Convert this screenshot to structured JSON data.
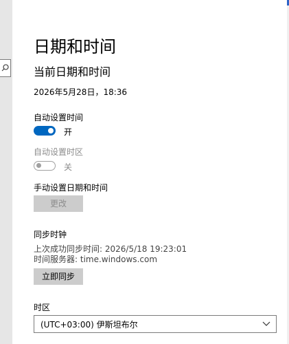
{
  "page": {
    "title": "日期和时间",
    "section_title": "当前日期和时间",
    "current_datetime": "2026年5月28日，18:36"
  },
  "auto_time": {
    "label": "自动设置时间",
    "state": "开"
  },
  "auto_timezone": {
    "label": "自动设置时区",
    "state": "关"
  },
  "manual": {
    "label": "手动设置日期和时间",
    "change_button": "更改"
  },
  "sync": {
    "label": "同步时钟",
    "last_sync": "上次成功同步时间: 2026/5/18 19:23:01",
    "server": "时间服务器: time.windows.com",
    "sync_button": "立即同步"
  },
  "timezone": {
    "label": "时区",
    "selected": "(UTC+03:00) 伊斯坦布尔"
  },
  "colors": {
    "accent": "#0067c0",
    "disabled_text": "#8c8c8c",
    "button_bg": "#cccccc"
  },
  "icons": {
    "search": "search-icon",
    "dropdown": "chevron-down-icon"
  }
}
